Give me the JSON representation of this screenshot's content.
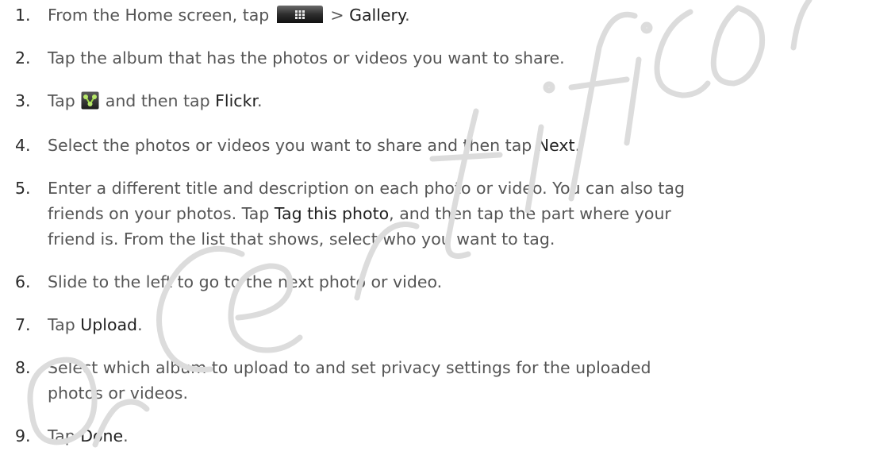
{
  "steps": [
    {
      "num": "1.",
      "parts": [
        "From the Home screen, tap ",
        " > ",
        "Gallery",
        "."
      ],
      "icon": "all-apps-icon"
    },
    {
      "num": "2.",
      "text": "Tap the album that has the photos or videos you want to share."
    },
    {
      "num": "3.",
      "parts": [
        "Tap ",
        " and then tap ",
        "Flickr",
        "."
      ],
      "icon": "share-icon"
    },
    {
      "num": "4.",
      "parts": [
        "Select the photos or videos you want to share and then tap ",
        "Next",
        "."
      ]
    },
    {
      "num": "5.",
      "lines": [
        "Enter a different title and description on each photo or video. You can also tag",
        [
          "friends on your photos. Tap ",
          "Tag this photo",
          ", and then tap the part where your"
        ],
        "friend is. From the list that shows, select who you want to tag."
      ]
    },
    {
      "num": "6.",
      "text": "Slide to the left to go to the next photo or video."
    },
    {
      "num": "7.",
      "parts": [
        "Tap ",
        "Upload",
        "."
      ]
    },
    {
      "num": "8.",
      "lines": [
        "Select which album to upload to and set privacy settings for the uploaded",
        "photos or videos."
      ]
    },
    {
      "num": "9.",
      "parts": [
        "Tap ",
        "Done",
        "."
      ]
    }
  ],
  "watermark": {
    "text": "For Certification",
    "color": "#dddddd"
  },
  "colors": {
    "body_text": "#555555",
    "emphasis_text": "#1f1f1f"
  }
}
